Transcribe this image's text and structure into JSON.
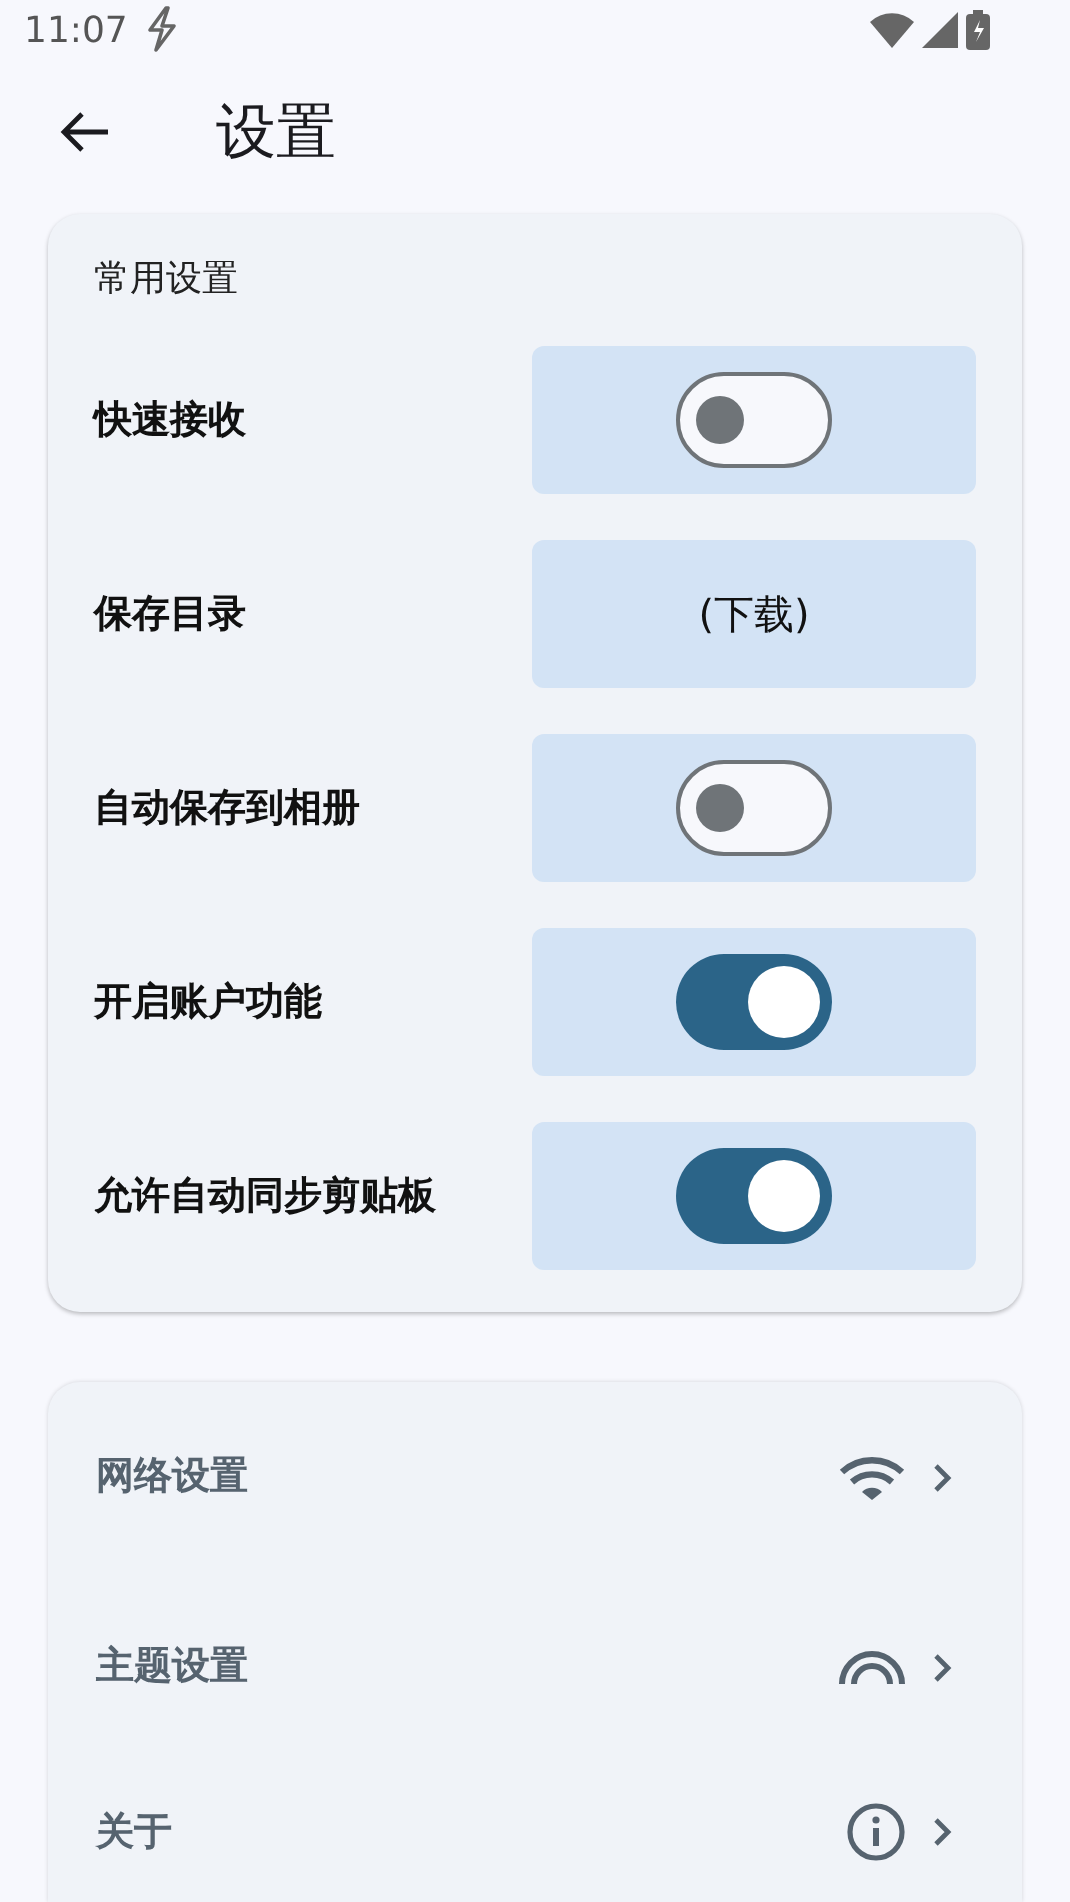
{
  "status_bar": {
    "time": "11:07"
  },
  "header": {
    "title": "设置"
  },
  "general": {
    "title": "常用设置",
    "rows": [
      {
        "kind": "toggle",
        "label": "快速接收",
        "on": false
      },
      {
        "kind": "value",
        "label": "保存目录",
        "value": "(下载)"
      },
      {
        "kind": "toggle",
        "label": "自动保存到相册",
        "on": false
      },
      {
        "kind": "toggle",
        "label": "开启账户功能",
        "on": true
      },
      {
        "kind": "toggle",
        "label": "允许自动同步剪贴板",
        "on": true
      }
    ]
  },
  "links": [
    {
      "kind": "wifi",
      "label": "网络设置"
    },
    {
      "kind": "theme",
      "label": "主题设置"
    },
    {
      "kind": "info",
      "label": "关于"
    }
  ]
}
